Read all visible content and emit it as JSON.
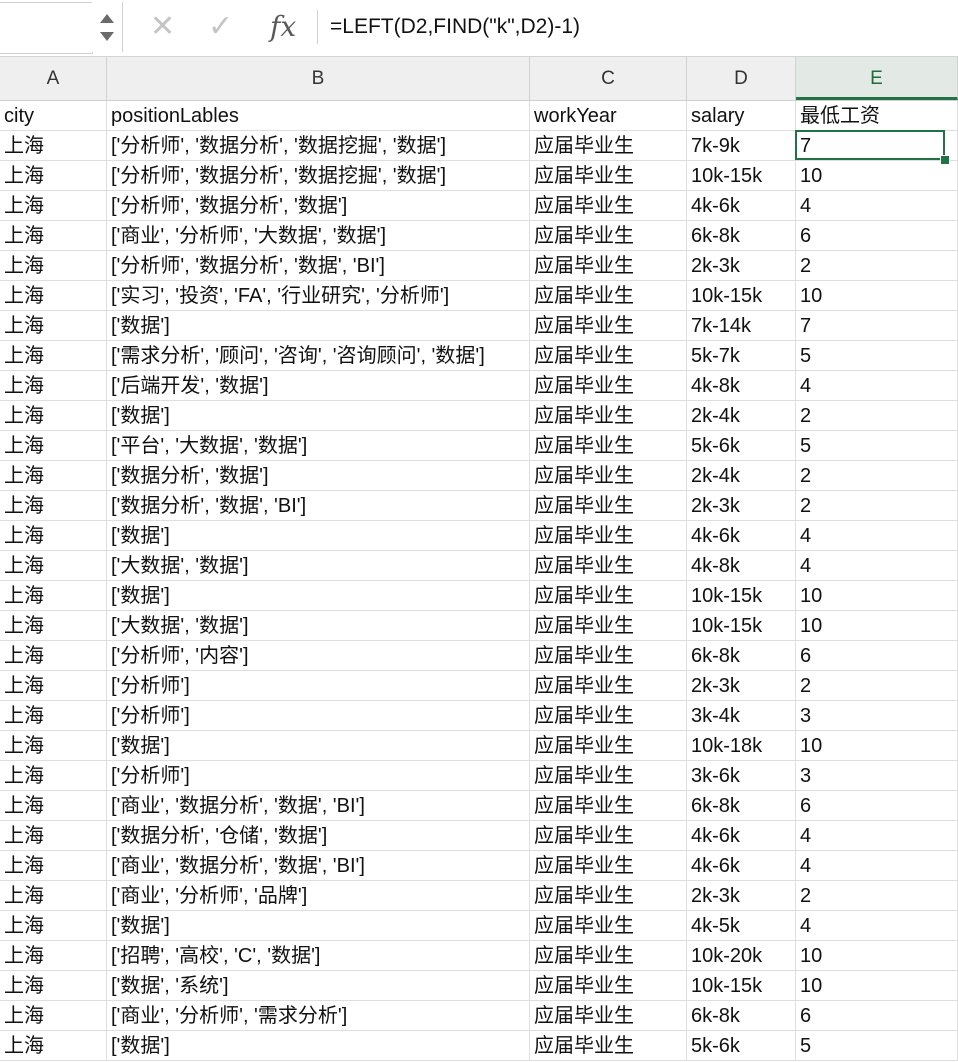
{
  "formula_bar": {
    "fx_label": "fx",
    "formula": "=LEFT(D2,FIND(\"k\",D2)-1)"
  },
  "columns": [
    "A",
    "B",
    "C",
    "D",
    "E"
  ],
  "selected_column": "E",
  "header_row": [
    "city",
    "positionLables",
    "workYear",
    "salary",
    "最低工资"
  ],
  "rows": [
    [
      "上海",
      "['分析师', '数据分析', '数据挖掘', '数据']",
      "应届毕业生",
      "7k-9k",
      "7"
    ],
    [
      "上海",
      "['分析师', '数据分析', '数据挖掘', '数据']",
      "应届毕业生",
      "10k-15k",
      "10"
    ],
    [
      "上海",
      "['分析师', '数据分析', '数据']",
      "应届毕业生",
      "4k-6k",
      "4"
    ],
    [
      "上海",
      "['商业', '分析师', '大数据', '数据']",
      "应届毕业生",
      "6k-8k",
      "6"
    ],
    [
      "上海",
      "['分析师', '数据分析', '数据', 'BI']",
      "应届毕业生",
      "2k-3k",
      "2"
    ],
    [
      "上海",
      "['实习', '投资', 'FA', '行业研究', '分析师']",
      "应届毕业生",
      "10k-15k",
      "10"
    ],
    [
      "上海",
      "['数据']",
      "应届毕业生",
      "7k-14k",
      "7"
    ],
    [
      "上海",
      "['需求分析', '顾问', '咨询', '咨询顾问', '数据']",
      "应届毕业生",
      "5k-7k",
      "5"
    ],
    [
      "上海",
      "['后端开发', '数据']",
      "应届毕业生",
      "4k-8k",
      "4"
    ],
    [
      "上海",
      "['数据']",
      "应届毕业生",
      "2k-4k",
      "2"
    ],
    [
      "上海",
      "['平台', '大数据', '数据']",
      "应届毕业生",
      "5k-6k",
      "5"
    ],
    [
      "上海",
      "['数据分析', '数据']",
      "应届毕业生",
      "2k-4k",
      "2"
    ],
    [
      "上海",
      "['数据分析', '数据', 'BI']",
      "应届毕业生",
      "2k-3k",
      "2"
    ],
    [
      "上海",
      "['数据']",
      "应届毕业生",
      "4k-6k",
      "4"
    ],
    [
      "上海",
      "['大数据', '数据']",
      "应届毕业生",
      "4k-8k",
      "4"
    ],
    [
      "上海",
      "['数据']",
      "应届毕业生",
      "10k-15k",
      "10"
    ],
    [
      "上海",
      "['大数据', '数据']",
      "应届毕业生",
      "10k-15k",
      "10"
    ],
    [
      "上海",
      "['分析师', '内容']",
      "应届毕业生",
      "6k-8k",
      "6"
    ],
    [
      "上海",
      "['分析师']",
      "应届毕业生",
      "2k-3k",
      "2"
    ],
    [
      "上海",
      "['分析师']",
      "应届毕业生",
      "3k-4k",
      "3"
    ],
    [
      "上海",
      "['数据']",
      "应届毕业生",
      "10k-18k",
      "10"
    ],
    [
      "上海",
      "['分析师']",
      "应届毕业生",
      "3k-6k",
      "3"
    ],
    [
      "上海",
      "['商业', '数据分析', '数据', 'BI']",
      "应届毕业生",
      "6k-8k",
      "6"
    ],
    [
      "上海",
      "['数据分析', '仓储', '数据']",
      "应届毕业生",
      "4k-6k",
      "4"
    ],
    [
      "上海",
      "['商业', '数据分析', '数据', 'BI']",
      "应届毕业生",
      "4k-6k",
      "4"
    ],
    [
      "上海",
      "['商业', '分析师', '品牌']",
      "应届毕业生",
      "2k-3k",
      "2"
    ],
    [
      "上海",
      "['数据']",
      "应届毕业生",
      "4k-5k",
      "4"
    ],
    [
      "上海",
      "['招聘', '高校', 'C', '数据']",
      "应届毕业生",
      "10k-20k",
      "10"
    ],
    [
      "上海",
      "['数据', '系统']",
      "应届毕业生",
      "10k-15k",
      "10"
    ],
    [
      "上海",
      "['商业', '分析师', '需求分析']",
      "应届毕业生",
      "6k-8k",
      "6"
    ],
    [
      "上海",
      "['数据']",
      "应届毕业生",
      "5k-6k",
      "5"
    ]
  ]
}
